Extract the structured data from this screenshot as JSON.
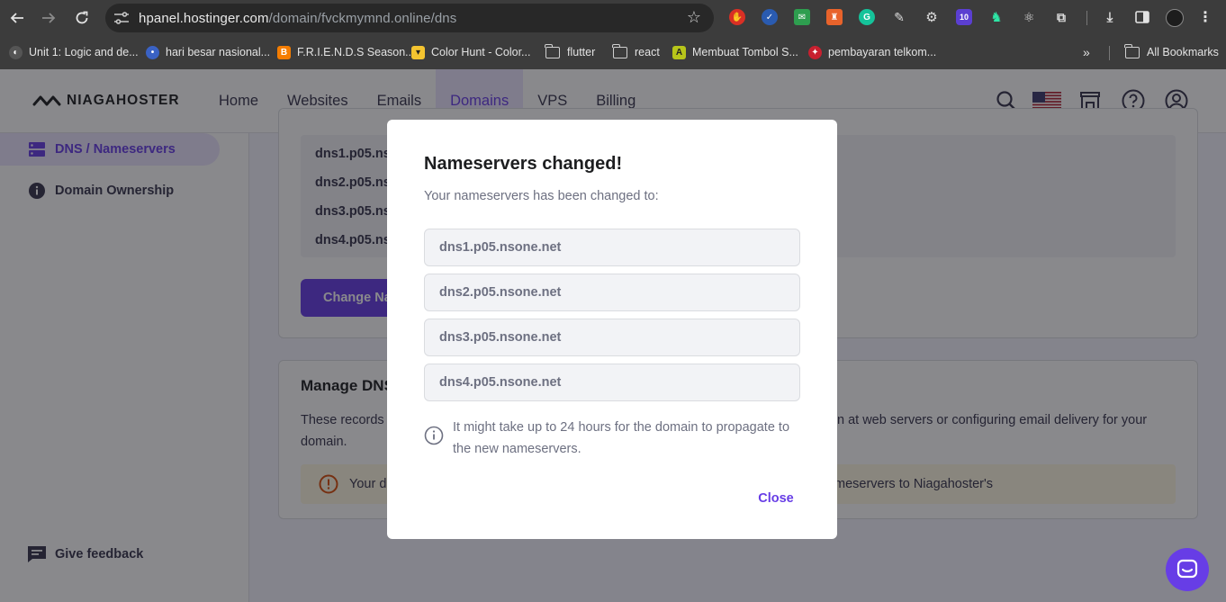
{
  "browser": {
    "url_host": "hpanel.hostinger.com",
    "url_path": "/domain/fvckmymnd.online/dns",
    "bookmarks": [
      {
        "label": "Unit 1: Logic and de...",
        "icon": "globe-icon"
      },
      {
        "label": "hari besar nasional...",
        "icon": "site-icon"
      },
      {
        "label": "F.R.I.E.N.D.S Season...",
        "icon": "blogger-icon"
      },
      {
        "label": "Color Hunt - Color...",
        "icon": "colorhunt-icon"
      },
      {
        "label": "flutter",
        "icon": "folder-icon"
      },
      {
        "label": "react",
        "icon": "folder-icon"
      },
      {
        "label": "Membuat Tombol S...",
        "icon": "site-icon"
      },
      {
        "label": "pembayaran telkom...",
        "icon": "site-icon"
      }
    ],
    "more_label": "»",
    "all_bookmarks": "All Bookmarks",
    "extension_badge": "10"
  },
  "header": {
    "brand": "NIAGAHOSTER",
    "nav": [
      "Home",
      "Websites",
      "Emails",
      "Domains",
      "VPS",
      "Billing"
    ],
    "active_nav": "Domains",
    "colors": {
      "accent": "#673de6",
      "active_bg": "#ebe4ff"
    }
  },
  "sidebar": {
    "items": [
      {
        "label": "DNS / Nameservers",
        "active": true
      },
      {
        "label": "Domain Ownership",
        "active": false
      }
    ],
    "feedback": "Give feedback"
  },
  "main": {
    "nameserver_lines": [
      "dns1.p05.ns",
      "dns2.p05.ns",
      "dns3.p05.ns",
      "dns4.p05.ns"
    ],
    "change_button": "Change Na",
    "manage_dns_title": "Manage DNS",
    "manage_dns_desc_left": "These records",
    "manage_dns_desc_right": "n at web servers or configuring email delivery for your",
    "manage_dns_desc_line2": "domain.",
    "warning_left": "Your d",
    "warning_right": "meservers to Niagahoster's"
  },
  "modal": {
    "title": "Nameservers changed!",
    "subtitle": "Your nameservers has been changed to:",
    "nameservers": [
      "dns1.p05.nsone.net",
      "dns2.p05.nsone.net",
      "dns3.p05.nsone.net",
      "dns4.p05.nsone.net"
    ],
    "info": "It might take up to 24 hours for the domain to propagate to the new nameservers.",
    "close_label": "Close"
  }
}
